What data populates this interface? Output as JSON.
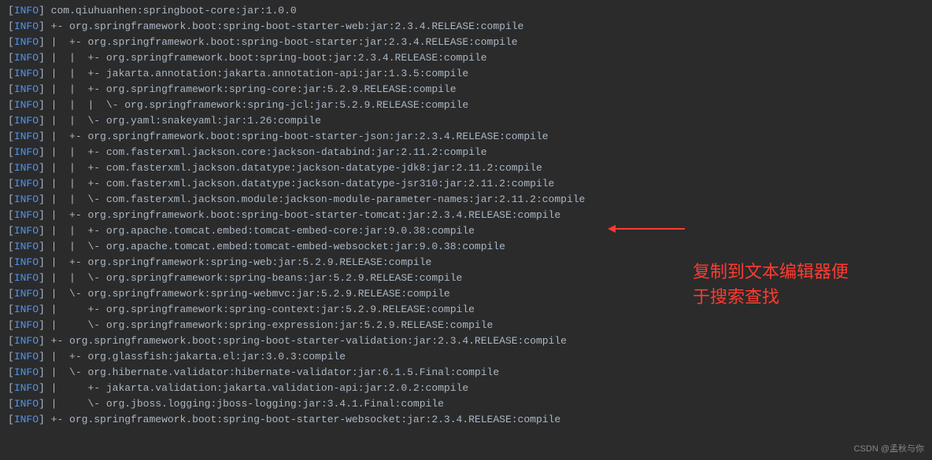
{
  "prefix": {
    "bracket_open": "[",
    "bracket_close": "]",
    "tag": "INFO"
  },
  "lines": [
    " com.qiuhuanhen:springboot-core:jar:1.0.0",
    " +- org.springframework.boot:spring-boot-starter-web:jar:2.3.4.RELEASE:compile",
    " |  +- org.springframework.boot:spring-boot-starter:jar:2.3.4.RELEASE:compile",
    " |  |  +- org.springframework.boot:spring-boot:jar:2.3.4.RELEASE:compile",
    " |  |  +- jakarta.annotation:jakarta.annotation-api:jar:1.3.5:compile",
    " |  |  +- org.springframework:spring-core:jar:5.2.9.RELEASE:compile",
    " |  |  |  \\- org.springframework:spring-jcl:jar:5.2.9.RELEASE:compile",
    " |  |  \\- org.yaml:snakeyaml:jar:1.26:compile",
    " |  +- org.springframework.boot:spring-boot-starter-json:jar:2.3.4.RELEASE:compile",
    " |  |  +- com.fasterxml.jackson.core:jackson-databind:jar:2.11.2:compile",
    " |  |  +- com.fasterxml.jackson.datatype:jackson-datatype-jdk8:jar:2.11.2:compile",
    " |  |  +- com.fasterxml.jackson.datatype:jackson-datatype-jsr310:jar:2.11.2:compile",
    " |  |  \\- com.fasterxml.jackson.module:jackson-module-parameter-names:jar:2.11.2:compile",
    " |  +- org.springframework.boot:spring-boot-starter-tomcat:jar:2.3.4.RELEASE:compile",
    " |  |  +- org.apache.tomcat.embed:tomcat-embed-core:jar:9.0.38:compile",
    " |  |  \\- org.apache.tomcat.embed:tomcat-embed-websocket:jar:9.0.38:compile",
    " |  +- org.springframework:spring-web:jar:5.2.9.RELEASE:compile",
    " |  |  \\- org.springframework:spring-beans:jar:5.2.9.RELEASE:compile",
    " |  \\- org.springframework:spring-webmvc:jar:5.2.9.RELEASE:compile",
    " |     +- org.springframework:spring-context:jar:5.2.9.RELEASE:compile",
    " |     \\- org.springframework:spring-expression:jar:5.2.9.RELEASE:compile",
    " +- org.springframework.boot:spring-boot-starter-validation:jar:2.3.4.RELEASE:compile",
    " |  +- org.glassfish:jakarta.el:jar:3.0.3:compile",
    " |  \\- org.hibernate.validator:hibernate-validator:jar:6.1.5.Final:compile",
    " |     +- jakarta.validation:jakarta.validation-api:jar:2.0.2:compile",
    " |     \\- org.jboss.logging:jboss-logging:jar:3.4.1.Final:compile",
    " +- org.springframework.boot:spring-boot-starter-websocket:jar:2.3.4.RELEASE:compile"
  ],
  "annotation": {
    "line1": "复制到文本编辑器便",
    "line2": "于搜索查找"
  },
  "watermark": "CSDN @孟秋与你"
}
